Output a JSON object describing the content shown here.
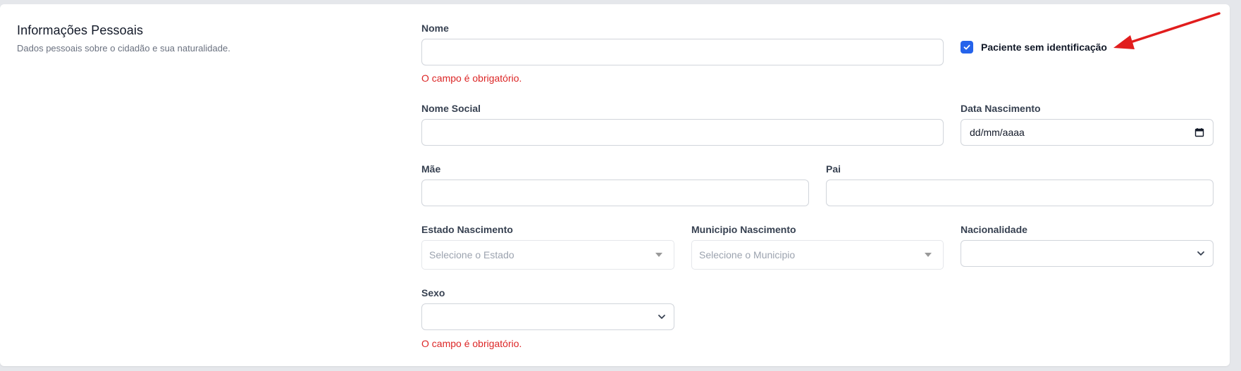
{
  "section": {
    "title": "Informações Pessoais",
    "description": "Dados pessoais sobre o cidadão e sua naturalidade."
  },
  "fields": {
    "nome": {
      "label": "Nome",
      "value": "",
      "error": "O campo é obrigatório."
    },
    "paciente_sem_identificacao": {
      "label": "Paciente sem identificação",
      "checked": true
    },
    "nome_social": {
      "label": "Nome Social",
      "value": ""
    },
    "data_nascimento": {
      "label": "Data Nascimento",
      "value": "dd/mm/aaaa"
    },
    "mae": {
      "label": "Mãe",
      "value": ""
    },
    "pai": {
      "label": "Pai",
      "value": ""
    },
    "estado_nascimento": {
      "label": "Estado Nascimento",
      "placeholder": "Selecione o Estado"
    },
    "municipio_nascimento": {
      "label": "Municipio Nascimento",
      "placeholder": "Selecione o Municipio"
    },
    "nacionalidade": {
      "label": "Nacionalidade",
      "value": ""
    },
    "sexo": {
      "label": "Sexo",
      "value": "",
      "error": "O campo é obrigatório."
    }
  },
  "icons": {
    "checkbox": "check-icon",
    "date": "calendar-icon",
    "select_caret": "caret-down-icon",
    "select_chevron": "chevron-down-icon",
    "annotation": "red-arrow-icon"
  },
  "colors": {
    "accent": "#2563eb",
    "error": "#dc2626",
    "annotation": "#e11d1d"
  }
}
